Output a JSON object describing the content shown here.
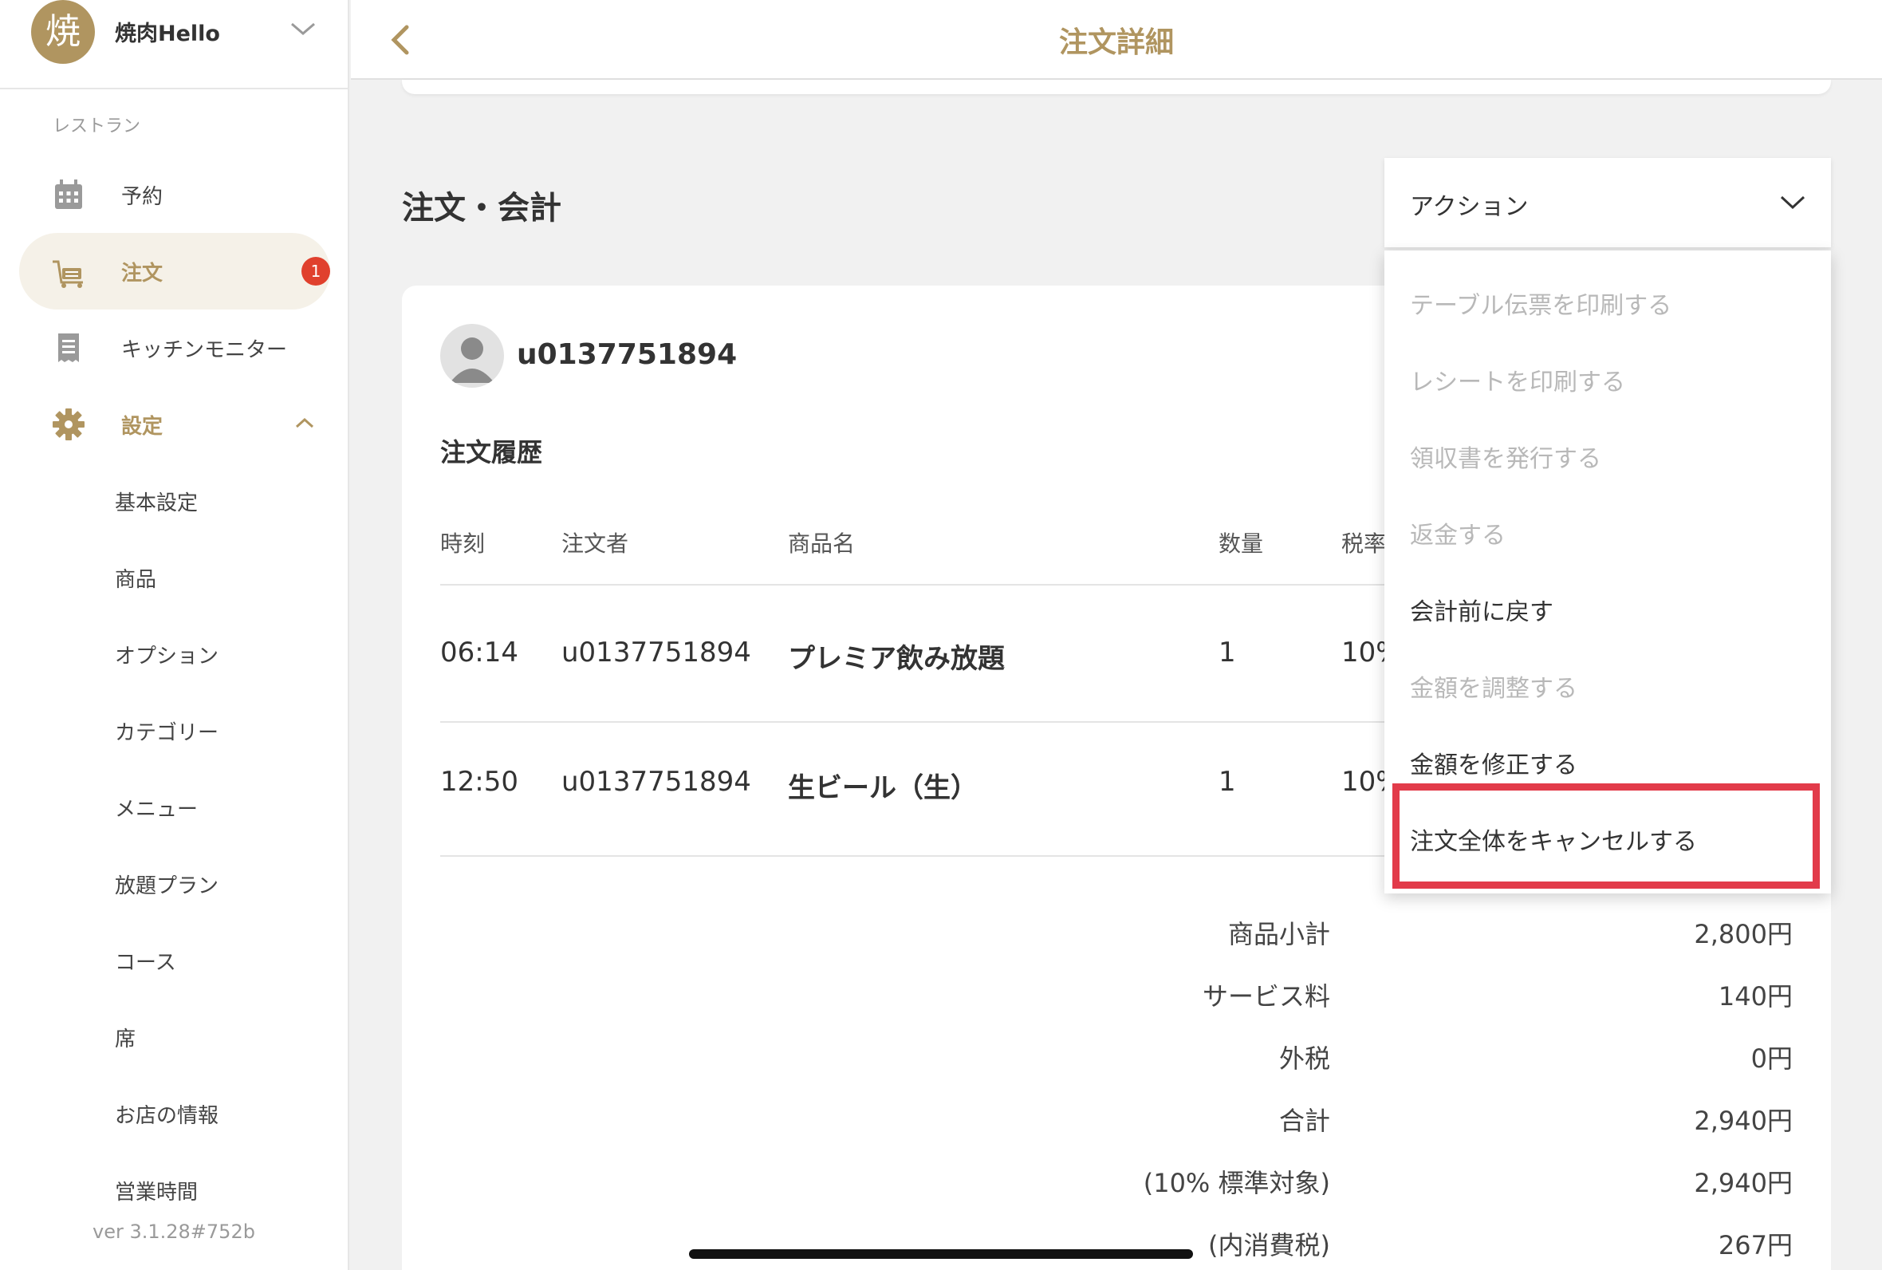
{
  "sidebar": {
    "store": {
      "logo_char": "焼",
      "name": "焼肉Hello"
    },
    "section_label": "レストラン",
    "nav": [
      {
        "label": "予約",
        "icon": "calendar-icon"
      },
      {
        "label": "注文",
        "icon": "cart-icon",
        "badge": "1"
      },
      {
        "label": "キッチンモニター",
        "icon": "receipt-icon"
      },
      {
        "label": "設定",
        "icon": "gear-icon"
      }
    ],
    "settings_items": [
      "基本設定",
      "商品",
      "オプション",
      "カテゴリー",
      "メニュー",
      "放題プラン",
      "コース",
      "席",
      "お店の情報",
      "営業時間"
    ],
    "version": "ver 3.1.28#752b"
  },
  "header": {
    "title": "注文詳細"
  },
  "section_title": "注文・会計",
  "action": {
    "label": "アクション",
    "menu": [
      {
        "label": "テーブル伝票を印刷する",
        "enabled": false
      },
      {
        "label": "レシートを印刷する",
        "enabled": false
      },
      {
        "label": "領収書を発行する",
        "enabled": false
      },
      {
        "label": "返金する",
        "enabled": false
      },
      {
        "label": "会計前に戻す",
        "enabled": true
      },
      {
        "label": "金額を調整する",
        "enabled": false
      },
      {
        "label": "金額を修正する",
        "enabled": true
      },
      {
        "label": "注文全体をキャンセルする",
        "enabled": true,
        "highlighted": true
      }
    ]
  },
  "order": {
    "customer": "u0137751894",
    "history_title": "注文履歴",
    "columns": [
      "時刻",
      "注文者",
      "商品名",
      "数量",
      "税率"
    ],
    "rows": [
      {
        "time": "06:14",
        "orderer": "u0137751894",
        "item": "プレミア飲み放題",
        "qty": "1",
        "tax": "10%"
      },
      {
        "time": "12:50",
        "orderer": "u0137751894",
        "item": "生ビール（生）",
        "qty": "1",
        "tax": "10%"
      }
    ],
    "totals": [
      {
        "label": "商品小計",
        "value": "2,800円"
      },
      {
        "label": "サービス料",
        "value": "140円"
      },
      {
        "label": "外税",
        "value": "0円"
      },
      {
        "label": "合計",
        "value": "2,940円"
      },
      {
        "label": "(10% 標準対象)",
        "value": "2,940円"
      },
      {
        "label": "(内消費税)",
        "value": "267円"
      }
    ]
  },
  "colors": {
    "brand_gold": "#b09560",
    "badge_red": "#e0402d",
    "highlight_red": "#e23b4a"
  }
}
